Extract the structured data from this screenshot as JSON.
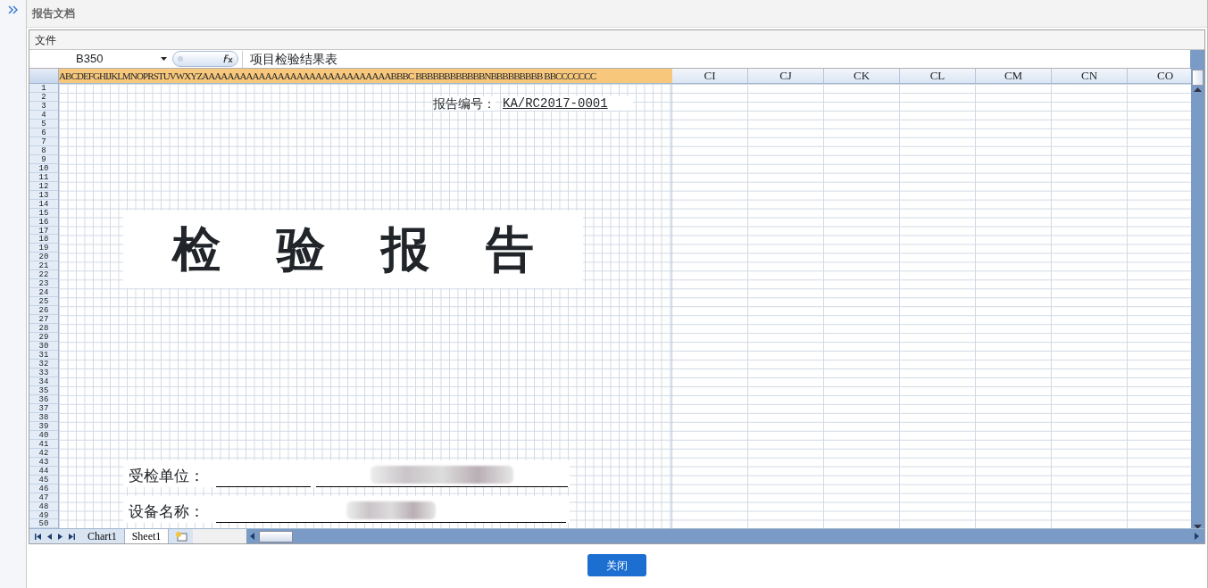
{
  "window": {
    "title": "报告文档"
  },
  "menu": [
    "文件"
  ],
  "formula_bar": {
    "cell_name": "B350",
    "value": "项目检验结果表"
  },
  "columns": {
    "narrow_headers": "ABCDEFGHIJKLMNOPRSTUVWXYZAAAAAAAAAAAAAAAAAAAAAAAAAAAAAABBBC BBBBBBBBBBBBNBBBBBBBBB BBCCCCCCC",
    "wide_headers": [
      "CI",
      "CJ",
      "CK",
      "CL",
      "CM",
      "CN",
      "CO"
    ]
  },
  "row_headers": [
    "1",
    "2",
    "3",
    "4",
    "5",
    "6",
    "7",
    "8",
    "9",
    "10",
    "11",
    "12",
    "13",
    "14",
    "15",
    "16",
    "17",
    "18",
    "19",
    "20",
    "21",
    "22",
    "23",
    "24",
    "25",
    "26",
    "27",
    "28",
    "29",
    "30",
    "31",
    "32",
    "33",
    "34",
    "35",
    "36",
    "37",
    "38",
    "39",
    "40",
    "41",
    "42",
    "43",
    "44",
    "45",
    "46",
    "47",
    "48",
    "49",
    "50"
  ],
  "report": {
    "number_label": "报告编号：",
    "number": "KA/RC2017-0001",
    "title": "检 验 报 告",
    "fields": [
      {
        "label": "受检单位："
      },
      {
        "label": "设备名称："
      }
    ]
  },
  "sheet_tabs": [
    {
      "label": "Chart1",
      "selected": false
    },
    {
      "label": "Sheet1",
      "selected": true
    }
  ],
  "buttons": [
    "关闭"
  ]
}
